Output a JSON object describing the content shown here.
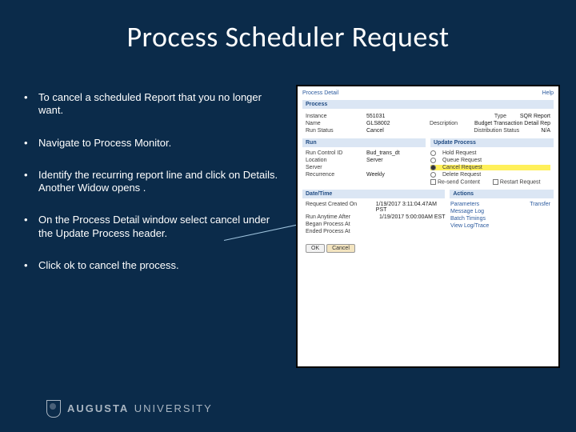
{
  "title": "Process Scheduler Request",
  "bullets": [
    "To cancel a scheduled Report that you no longer want.",
    "Navigate to Process Monitor.",
    "Identify the recurring report line and click on Details. Another Widow opens .",
    "On the Process Detail window select cancel under the Update Process header.",
    "Click ok to cancel the process."
  ],
  "footer": {
    "brand1": "AUGUSTA",
    "brand2": "UNIVERSITY"
  },
  "shot": {
    "page_title": "Process Detail",
    "help": "Help",
    "section_process": "Process",
    "instance_lbl": "Instance",
    "instance_val": "551031",
    "type_lbl": "Type",
    "type_val": "SQR Report",
    "name_lbl": "Name",
    "name_val": "GLS8002",
    "desc_lbl": "Description",
    "desc_val": "Budget Transaction Detail Rep",
    "runstatus_lbl": "Run Status",
    "runstatus_val": "Cancel",
    "diststatus_lbl": "Distribution Status",
    "diststatus_val": "N/A",
    "section_run": "Run",
    "section_update": "Update Process",
    "runctl_lbl": "Run Control ID",
    "runctl_val": "Bud_trans_dt",
    "location_lbl": "Location",
    "location_val": "Server",
    "server_lbl": "Server",
    "server_val": "",
    "recurrence_lbl": "Recurrence",
    "recurrence_val": "Weekly",
    "opt_hold": "Hold Request",
    "opt_queue": "Queue Request",
    "opt_cancel": "Cancel Request",
    "opt_delete": "Delete Request",
    "opt_resend": "Re-send Content",
    "opt_restart": "Restart Request",
    "section_datetime": "Date/Time",
    "section_actions": "Actions",
    "reqcreated_lbl": "Request Created On",
    "reqcreated_val": "1/19/2017 3:11:04.47AM PST",
    "runafter_lbl": "Run Anytime After",
    "runafter_val": "1/19/2017 5:00:00AM EST",
    "began_lbl": "Began Process At",
    "began_val": "",
    "ended_lbl": "Ended Process At",
    "ended_val": "",
    "act_params": "Parameters",
    "act_transfer": "Transfer",
    "act_msglog": "Message Log",
    "act_batch": "Batch Timings",
    "act_viewlog": "View Log/Trace",
    "btn_ok": "OK",
    "btn_cancel": "Cancel"
  }
}
